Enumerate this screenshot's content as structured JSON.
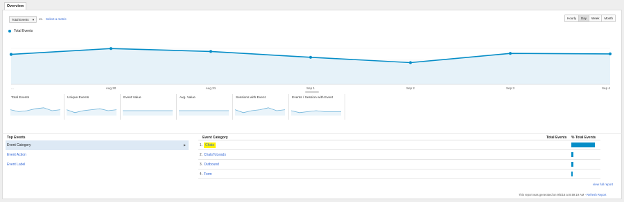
{
  "tab": {
    "label": "Overview"
  },
  "controls": {
    "metric_select": "Total Events",
    "vs_label": "vs.",
    "select_metric": "Select a metric",
    "granularity": [
      "Hourly",
      "Day",
      "Week",
      "Month"
    ],
    "active_granularity": "Day"
  },
  "legend": {
    "label": "Total Events",
    "color": "#058dc7"
  },
  "chart_data": {
    "type": "area",
    "x": [
      "...",
      "Aug 30",
      "Aug 31",
      "Sep 1",
      "Sep 2",
      "Sep 3",
      "Sep 4"
    ],
    "series": [
      {
        "name": "Total Events",
        "values": [
          62,
          74,
          68,
          56,
          45,
          64,
          63
        ]
      }
    ],
    "ylim": [
      0,
      100
    ],
    "grid": true,
    "color": "#058dc7"
  },
  "scorecards": [
    {
      "label": "Total Events",
      "spark": [
        6,
        4,
        5,
        7,
        8,
        5,
        6
      ]
    },
    {
      "label": "Unique Events",
      "spark": [
        6,
        3,
        5,
        6,
        7,
        5,
        6
      ]
    },
    {
      "label": "Event Value",
      "spark": [
        5,
        5,
        5,
        5,
        5,
        5,
        5
      ]
    },
    {
      "label": "Avg. Value",
      "spark": [
        5,
        5,
        5,
        5,
        5,
        5,
        5
      ]
    },
    {
      "label": "Sessions with Event",
      "spark": [
        6,
        3,
        5,
        6,
        8,
        5,
        6
      ]
    },
    {
      "label": "Events / Session with Event",
      "spark": [
        5,
        3,
        4,
        5,
        4,
        4,
        4
      ]
    }
  ],
  "top_events": {
    "header": "Top Events",
    "items": [
      "Event Category",
      "Event Action",
      "Event Label"
    ]
  },
  "table": {
    "headers": {
      "category": "Event Category",
      "total": "Total Events",
      "pct": "% Total Events"
    },
    "rows": [
      {
        "num": "1.",
        "name": "Chats",
        "pct": 100
      },
      {
        "num": "2.",
        "name": "ChatsToLeads",
        "pct": 8
      },
      {
        "num": "3.",
        "name": "Outbound",
        "pct": 8
      },
      {
        "num": "4.",
        "name": "Form",
        "pct": 6
      }
    ]
  },
  "view_full_report": "view full report",
  "footer": {
    "generated": "This report was generated on 9/5/18 at 8:59:19 AM -",
    "refresh": "Refresh Report"
  }
}
